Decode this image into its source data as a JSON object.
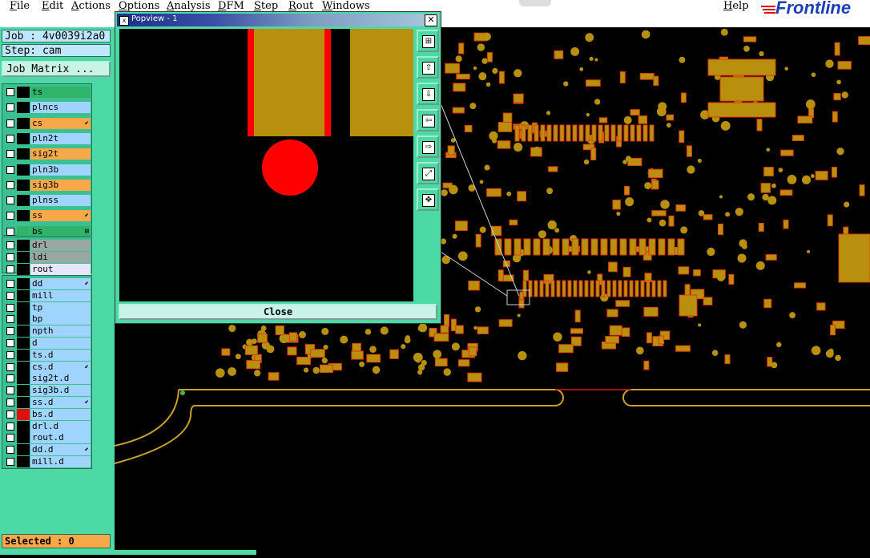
{
  "menubar": {
    "items": [
      "File",
      "Edit",
      "Actions",
      "Options",
      "Analysis",
      "DFM",
      "Step",
      "Rout",
      "Windows"
    ],
    "help": "Help",
    "brand": "Frontline"
  },
  "info": {
    "job": "Job : 4v0039i2a0",
    "step": "Step: cam",
    "job_matrix": "Job Matrix ..."
  },
  "layers_group1": [
    {
      "name": "ts",
      "color": "#2fb46a",
      "mark": "",
      "sw": "#000"
    },
    {
      "name": "plncs",
      "color": "#9fd4ff",
      "mark": "",
      "sw": "#000"
    },
    {
      "name": "cs",
      "color": "#f7a94a",
      "mark": "⬋",
      "sw": "#000"
    },
    {
      "name": "pln2t",
      "color": "#9fd4ff",
      "mark": "",
      "sw": "#000"
    },
    {
      "name": "sig2t",
      "color": "#f7a94a",
      "mark": "",
      "sw": "#000"
    },
    {
      "name": "pln3b",
      "color": "#9fd4ff",
      "mark": "",
      "sw": "#000"
    },
    {
      "name": "sig3b",
      "color": "#f7a94a",
      "mark": "",
      "sw": "#000"
    },
    {
      "name": "plnss",
      "color": "#9fd4ff",
      "mark": "",
      "sw": "#000"
    },
    {
      "name": "ss",
      "color": "#f7a94a",
      "mark": "⬋",
      "sw": "#000"
    },
    {
      "name": "bs",
      "color": "#2fb46a",
      "mark": "⊞",
      "sw": "#2fb46a"
    }
  ],
  "layers_group2": [
    {
      "name": "drl",
      "color": "#9aa8a4",
      "mark": "",
      "sw": "#000"
    },
    {
      "name": "ldi",
      "color": "#9aa8a4",
      "mark": "",
      "sw": "#000"
    },
    {
      "name": "rout",
      "color": "#e6e6ff",
      "mark": "",
      "sw": "#000"
    }
  ],
  "layers_group3": [
    {
      "name": "dd",
      "color": "#9fd4ff",
      "mark": "⬋",
      "sw": "#000"
    },
    {
      "name": "mill",
      "color": "#9fd4ff",
      "mark": "",
      "sw": "#000"
    },
    {
      "name": "tp",
      "color": "#9fd4ff",
      "mark": "",
      "sw": "#000"
    },
    {
      "name": "bp",
      "color": "#9fd4ff",
      "mark": "",
      "sw": "#000"
    },
    {
      "name": "npth",
      "color": "#9fd4ff",
      "mark": "",
      "sw": "#000"
    },
    {
      "name": "d",
      "color": "#9fd4ff",
      "mark": "",
      "sw": "#000"
    },
    {
      "name": "ts.d",
      "color": "#9fd4ff",
      "mark": "",
      "sw": "#000"
    },
    {
      "name": "cs.d",
      "color": "#9fd4ff",
      "mark": "⬋",
      "sw": "#000"
    },
    {
      "name": "sig2t.d",
      "color": "#9fd4ff",
      "mark": "",
      "sw": "#000"
    },
    {
      "name": "sig3b.d",
      "color": "#9fd4ff",
      "mark": "",
      "sw": "#000"
    },
    {
      "name": "ss.d",
      "color": "#9fd4ff",
      "mark": "⬋",
      "sw": "#000"
    },
    {
      "name": "bs.d",
      "color": "#9fd4ff",
      "mark": "",
      "sw": "#e01010"
    },
    {
      "name": "drl.d",
      "color": "#9fd4ff",
      "mark": "",
      "sw": "#000"
    },
    {
      "name": "rout.d",
      "color": "#9fd4ff",
      "mark": "",
      "sw": "#000"
    },
    {
      "name": "dd.d",
      "color": "#9fd4ff",
      "mark": "⬋",
      "sw": "#000"
    },
    {
      "name": "mill.d",
      "color": "#9fd4ff",
      "mark": "",
      "sw": "#000"
    }
  ],
  "status": {
    "selected": "Selected : 0"
  },
  "popview": {
    "title": "Popview - 1",
    "close_label": "Close",
    "tools": [
      "zoom-in-icon",
      "pan-up-icon",
      "pan-down-icon",
      "pan-left-icon",
      "pan-right-icon",
      "zoom-fit-icon",
      "zoom-home-icon"
    ]
  },
  "colors": {
    "pad": "#b8900e",
    "pad_outline": "#e03a10",
    "highlight": "#ff0000",
    "panel": "#4cd9a6"
  }
}
